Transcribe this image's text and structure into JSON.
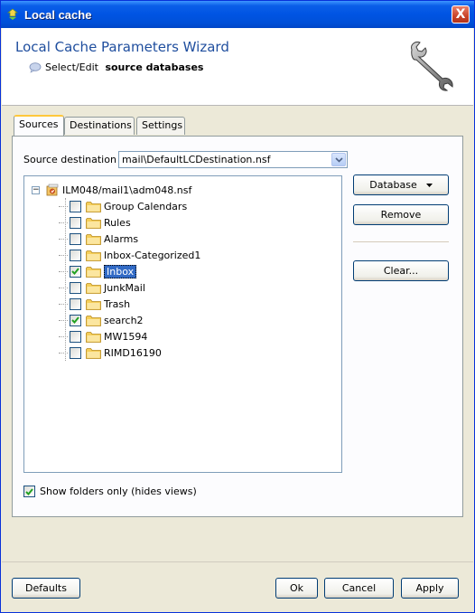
{
  "window": {
    "title": "Local cache",
    "close_label": "X"
  },
  "header": {
    "wizard_title": "Local Cache Parameters Wizard",
    "subtitle_prefix": "Select/Edit ",
    "subtitle_bold": "source databases"
  },
  "tabs": [
    {
      "label": "Sources",
      "active": true
    },
    {
      "label": "Destinations",
      "active": false
    },
    {
      "label": "Settings",
      "active": false
    }
  ],
  "source_destination": {
    "label": "Source destination",
    "value": "mail\\DefaultLCDestination.nsf"
  },
  "tree": {
    "root": {
      "label": "ILM048/mail1\\adm048.nsf",
      "expanded": true,
      "expander": "−"
    },
    "items": [
      {
        "label": "Group Calendars",
        "checked": false,
        "selected": false
      },
      {
        "label": "Rules",
        "checked": false,
        "selected": false
      },
      {
        "label": "Alarms",
        "checked": false,
        "selected": false
      },
      {
        "label": "Inbox-Categorized1",
        "checked": false,
        "selected": false
      },
      {
        "label": "Inbox",
        "checked": true,
        "selected": true
      },
      {
        "label": "JunkMail",
        "checked": false,
        "selected": false
      },
      {
        "label": "Trash",
        "checked": false,
        "selected": false
      },
      {
        "label": "search2",
        "checked": true,
        "selected": false
      },
      {
        "label": "MW1594",
        "checked": false,
        "selected": false
      },
      {
        "label": "RIMD16190",
        "checked": false,
        "selected": false
      }
    ]
  },
  "side_buttons": {
    "database": "Database",
    "remove": "Remove",
    "clear": "Clear..."
  },
  "show_folders_only": {
    "label": "Show folders only (hides views)",
    "checked": true
  },
  "footer": {
    "defaults": "Defaults",
    "ok": "Ok",
    "cancel": "Cancel",
    "apply": "Apply"
  },
  "colors": {
    "titlebar": "#0054e3",
    "wizard_title": "#1f4e9e",
    "selection": "#316ac5",
    "check": "#21a121",
    "folder": "#f5cf5a"
  }
}
